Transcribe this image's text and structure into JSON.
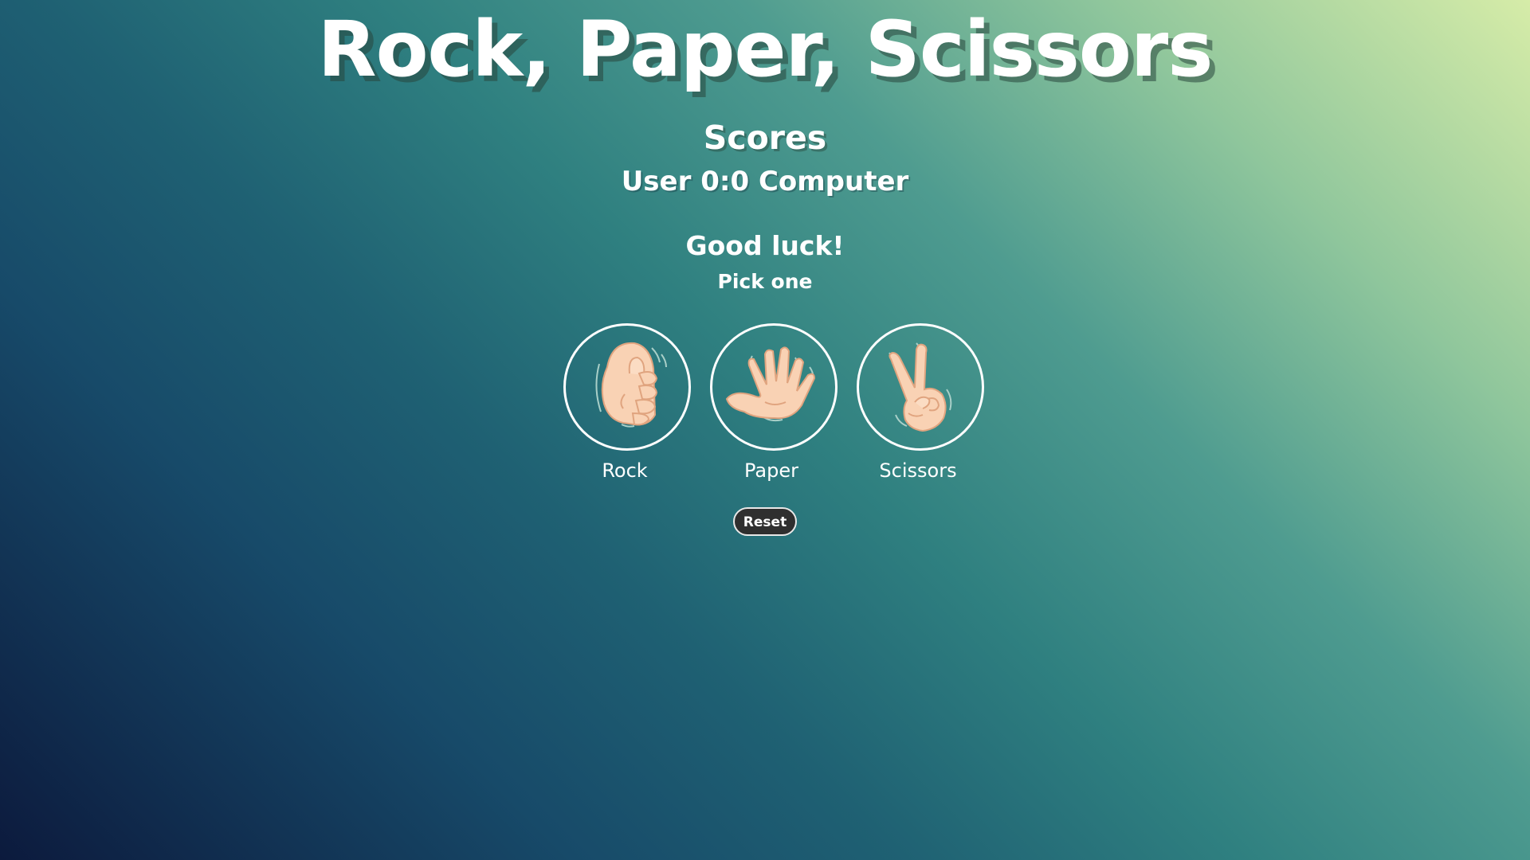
{
  "title": "Rock, Paper, Scissors",
  "scores": {
    "heading": "Scores",
    "line": "User 0:0 Computer",
    "user": 0,
    "computer": 0
  },
  "status": {
    "message": "Good luck!",
    "prompt": "Pick one"
  },
  "choices": [
    {
      "label": "Rock",
      "icon": "fist-hand-icon"
    },
    {
      "label": "Paper",
      "icon": "open-hand-icon"
    },
    {
      "label": "Scissors",
      "icon": "peace-hand-icon"
    }
  ],
  "controls": {
    "reset_label": "Reset"
  },
  "colors": {
    "text": "#ffffff",
    "skin": "#f9d2b4",
    "skin_outline": "#e0a47f",
    "reset_background": "#2f2f2f",
    "gradient_light": "#d6eca8",
    "gradient_mid": "#2f8080",
    "gradient_dark": "#0c1a3d"
  }
}
